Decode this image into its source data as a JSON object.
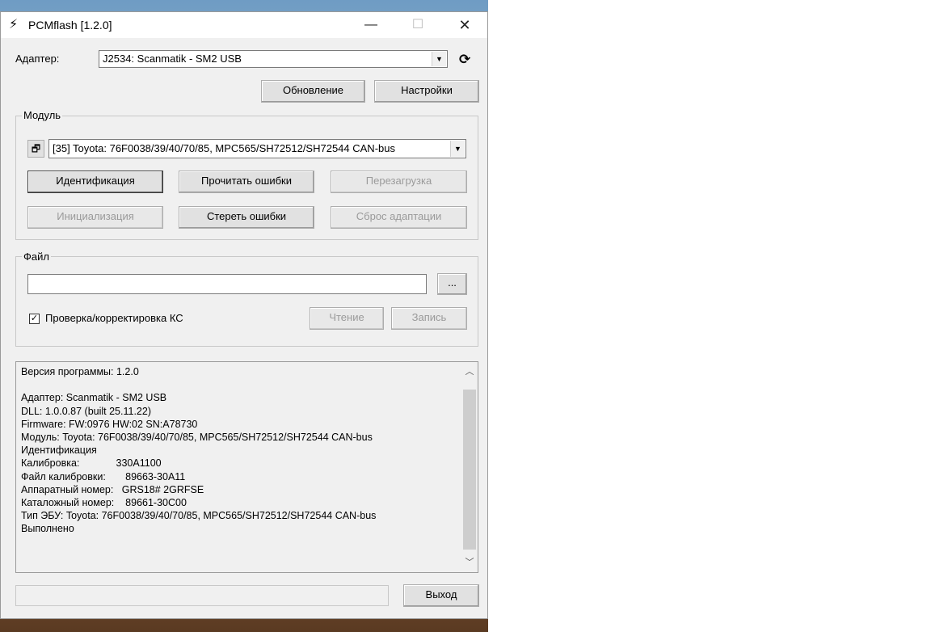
{
  "window": {
    "title": "PCMflash [1.2.0]",
    "controls": {
      "minimize": "—",
      "maximize": "☐",
      "close": "✕"
    }
  },
  "adapter": {
    "label": "Адаптер:",
    "selected": "J2534: Scanmatik - SM2 USB",
    "refresh_icon": "refresh-icon",
    "update_button": "Обновление",
    "settings_button": "Настройки"
  },
  "module": {
    "group_title": "Модуль",
    "selected": "[35] Toyota: 76F0038/39/40/70/85, MPC565/SH72512/SH72544 CAN-bus",
    "buttons": {
      "identify": "Идентификация",
      "read_errors": "Прочитать ошибки",
      "reboot": "Перезагрузка",
      "init": "Инициализация",
      "clear_errors": "Стереть ошибки",
      "reset_adapt": "Сброс адаптации"
    }
  },
  "file": {
    "group_title": "Файл",
    "path_value": "",
    "browse_button": "...",
    "checksum_label": "Проверка/корректировка КС",
    "checksum_checked": true,
    "read_button": "Чтение",
    "write_button": "Запись"
  },
  "log": {
    "lines": [
      "Версия программы: 1.2.0",
      "",
      "Адаптер: Scanmatik - SM2 USB",
      "DLL: 1.0.0.87 (built 25.11.22)",
      "Firmware: FW:0976 HW:02 SN:A78730",
      "Модуль: Toyota: 76F0038/39/40/70/85, MPC565/SH72512/SH72544 CAN-bus",
      "Идентификация",
      "Калибровка:             330A1100",
      "Файл калибровки:       89663-30A11",
      "Аппаратный номер:   GRS18# 2GRFSE",
      "Каталожный номер:    89661-30C00",
      "Тип ЭБУ: Toyota: 76F0038/39/40/70/85, MPC565/SH72512/SH72544 CAN-bus",
      "Выполнено"
    ]
  },
  "footer": {
    "status_text": "",
    "exit_button": "Выход"
  }
}
